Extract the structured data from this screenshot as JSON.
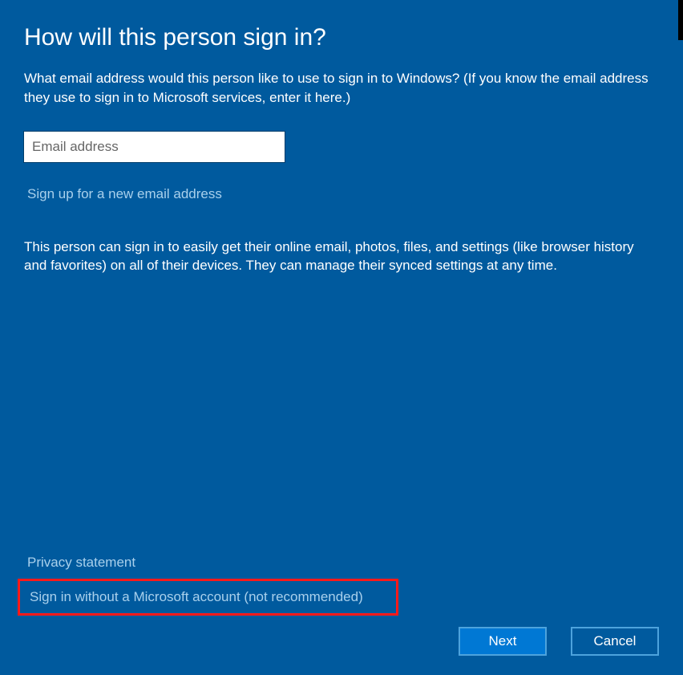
{
  "header": {
    "title": "How will this person sign in?",
    "instruction": "What email address would this person like to use to sign in to Windows? (If you know the email address they use to sign in to Microsoft services, enter it here.)"
  },
  "email_field": {
    "value": "",
    "placeholder": "Email address"
  },
  "links": {
    "signup": "Sign up for a new email address",
    "privacy": "Privacy statement",
    "no_microsoft_account": "Sign in without a Microsoft account (not recommended)"
  },
  "description": "This person can sign in to easily get their online email, photos, files, and settings (like browser history and favorites) on all of their devices. They can manage their synced settings at any time.",
  "buttons": {
    "next": "Next",
    "cancel": "Cancel"
  }
}
